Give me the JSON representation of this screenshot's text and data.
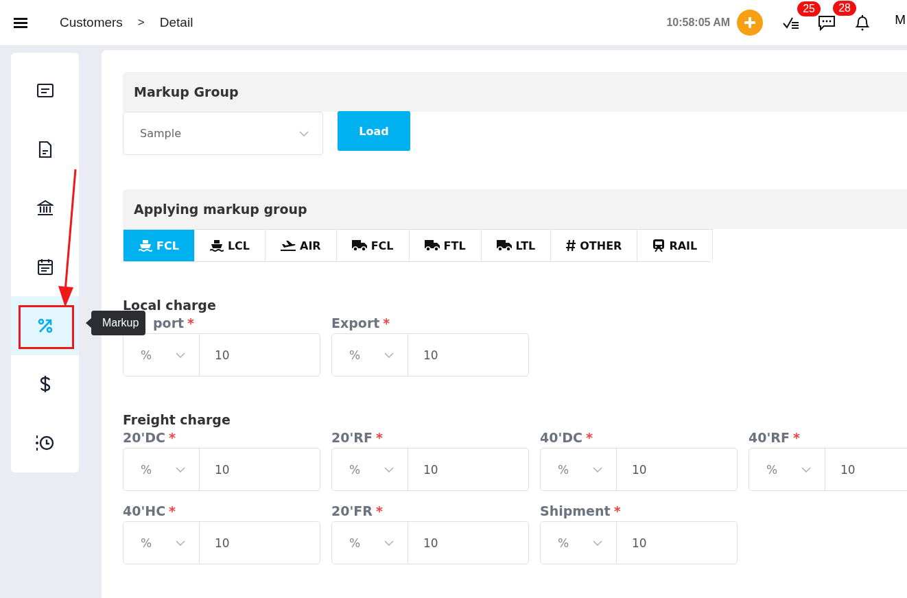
{
  "header": {
    "breadcrumb": [
      "Customers",
      ">",
      "Detail"
    ],
    "time": "10:58:05 AM",
    "badges": [
      {
        "kind": "tasks",
        "count": "25"
      },
      {
        "kind": "messages",
        "count": "28"
      },
      {
        "kind": "bell"
      }
    ],
    "user": "M"
  },
  "sidebar": {
    "items": [
      {
        "kind": "card",
        "selected": false
      },
      {
        "kind": "document",
        "selected": false
      },
      {
        "kind": "bank",
        "selected": false
      },
      {
        "kind": "calendar",
        "selected": false
      },
      {
        "kind": "percent",
        "selected": true
      },
      {
        "kind": "dollar",
        "selected": false
      },
      {
        "kind": "history",
        "selected": false
      }
    ],
    "tooltip": "Markup"
  },
  "markup_group": {
    "title": "Markup Group",
    "select": {
      "value": "Sample"
    },
    "button": "Load"
  },
  "applying": {
    "title": "Applying markup group",
    "tabs": [
      {
        "kind": "ship",
        "label": "FCL",
        "selected": true
      },
      {
        "kind": "ship",
        "label": "LCL",
        "selected": false
      },
      {
        "kind": "plane",
        "label": "AIR",
        "selected": false
      },
      {
        "kind": "truck",
        "label": "FCL",
        "selected": false
      },
      {
        "kind": "truck",
        "label": "FTL",
        "selected": false
      },
      {
        "kind": "truck",
        "label": "LTL",
        "selected": false
      },
      {
        "kind": "hash",
        "label": "OTHER",
        "selected": false
      },
      {
        "kind": "train",
        "label": "RAIL",
        "selected": false
      }
    ]
  },
  "sections": [
    {
      "title": "Local charge",
      "fields": [
        {
          "label": "port",
          "required_mark": "*",
          "unit": "%",
          "value": "10"
        },
        {
          "label": "Export",
          "required_mark": "*",
          "unit": "%",
          "value": "10"
        }
      ]
    },
    {
      "title": "Freight charge",
      "fields": [
        {
          "label": "20'DC",
          "required_mark": "*",
          "unit": "%",
          "value": "10"
        },
        {
          "label": "20'RF",
          "required_mark": "*",
          "unit": "%",
          "value": "10"
        },
        {
          "label": "40'DC",
          "required_mark": "*",
          "unit": "%",
          "value": "10"
        },
        {
          "label": "40'RF",
          "required_mark": "*",
          "unit": "%",
          "value": "10"
        },
        {
          "label": "40'HC",
          "required_mark": "*",
          "unit": "%",
          "value": "10"
        },
        {
          "label": "20'FR",
          "required_mark": "*",
          "unit": "%",
          "value": "10"
        },
        {
          "label": "Shipment",
          "required_mark": "*",
          "unit": "%",
          "value": "10"
        }
      ]
    }
  ]
}
